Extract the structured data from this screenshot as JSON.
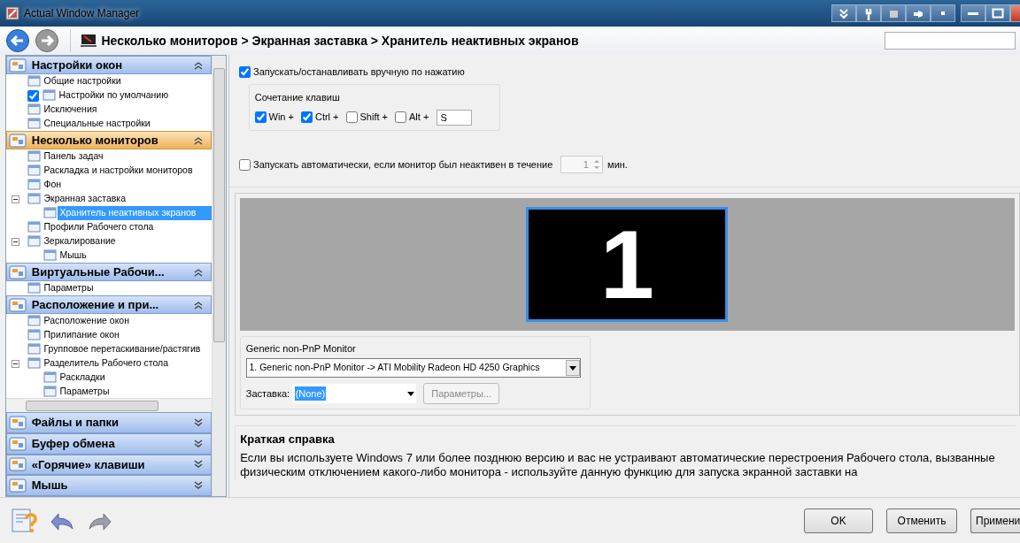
{
  "window": {
    "title": "Actual Window Manager"
  },
  "nav": {
    "breadcrumb": "Несколько мониторов > Экранная заставка > Хранитель неактивных экранов"
  },
  "sidebar": {
    "groups": [
      {
        "title": "Настройки окон",
        "expanded": true,
        "selected": false,
        "items": [
          {
            "label": "Общие настройки",
            "selected": false
          },
          {
            "label": "Настройки по умолчанию",
            "selected": false,
            "checked": true
          },
          {
            "label": "Исключения",
            "selected": false
          },
          {
            "label": "Специальные настройки",
            "selected": false
          }
        ]
      },
      {
        "title": "Несколько мониторов",
        "expanded": true,
        "selected": true,
        "items": [
          {
            "label": "Панель задач",
            "selected": false
          },
          {
            "label": "Раскладка и настройки мониторов",
            "selected": false
          },
          {
            "label": "Фон",
            "selected": false
          },
          {
            "label": "Экранная заставка",
            "selected": false,
            "expanded": true,
            "children": [
              {
                "label": "Хранитель неактивных экранов",
                "selected": true
              }
            ]
          },
          {
            "label": "Профили Рабочего стола",
            "selected": false
          },
          {
            "label": "Зеркалирование",
            "selected": false,
            "expanded": true,
            "children": [
              {
                "label": "Мышь",
                "selected": false
              }
            ]
          }
        ]
      },
      {
        "title": "Виртуальные Рабочи...",
        "expanded": true,
        "selected": false,
        "items": [
          {
            "label": "Параметры",
            "selected": false
          }
        ]
      },
      {
        "title": "Расположение и при...",
        "expanded": true,
        "selected": false,
        "items": [
          {
            "label": "Расположение окон",
            "selected": false
          },
          {
            "label": "Прилипание окон",
            "selected": false
          },
          {
            "label": "Групповое перетаскивание/растягив",
            "selected": false
          },
          {
            "label": "Разделитель Рабочего стола",
            "selected": false,
            "expanded": true,
            "children": [
              {
                "label": "Раскладки",
                "selected": false
              },
              {
                "label": "Параметры",
                "selected": false
              }
            ]
          }
        ]
      }
    ],
    "collapsed_groups": [
      {
        "title": "Файлы и папки",
        "expanded": false
      },
      {
        "title": "Буфер обмена",
        "expanded": false
      },
      {
        "title": "«Горячие» клавиши",
        "expanded": false
      },
      {
        "title": "Мышь",
        "expanded": false
      }
    ]
  },
  "content": {
    "manual": {
      "label": "Запускать/останавливать вручную по нажатию",
      "checked": true
    },
    "hotkey": {
      "legend": "Сочетание клавиш",
      "keys": [
        {
          "label": "Win +",
          "checked": true
        },
        {
          "label": "Ctrl +",
          "checked": true
        },
        {
          "label": "Shift +",
          "checked": false
        },
        {
          "label": "Alt +",
          "checked": false
        }
      ],
      "key": "S"
    },
    "auto": {
      "label": "Запускать автоматически, если монитор был неактивен в течение",
      "checked": false,
      "value": "1",
      "unit": "мин."
    },
    "monitors": [
      {
        "number": "1",
        "selected": true
      }
    ],
    "monitor_group": {
      "legend": "Generic non-PnP Monitor",
      "device": "1. Generic non-PnP Monitor -> ATI Mobility Radeon HD 4250 Graphics",
      "screensaver_label": "Заставка:",
      "screensaver": "(None)",
      "settings_button": {
        "label": "Параметры...",
        "disabled": true
      }
    },
    "help": {
      "title": "Краткая справка",
      "text": "Если вы используете Windows 7 или более позднюю версию и вас не устраивают автоматические перестроения Рабочего стола, вызванные физическим отключением какого-либо монитора - используйте данную функцию для запуска экранной заставки на"
    }
  },
  "footer": {
    "buttons": [
      "OK",
      "Отменить",
      "Примени"
    ]
  }
}
